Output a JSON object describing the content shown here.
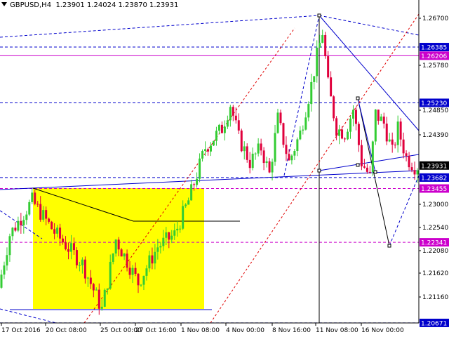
{
  "header": {
    "symbol_timeframe": "GBPUSD,H4",
    "ohlc": "1.23901 1.24024 1.23870 1.23931"
  },
  "colors": {
    "background": "#ffffff",
    "up_candle": "#33cc33",
    "down_candle": "#e0003c",
    "rectangle": "#ffff00",
    "trend_blue": "#0000cc",
    "level_magenta": "#cc00cc",
    "channel_red": "#e00000",
    "tag_blue": "#0000cc",
    "tag_magenta": "#cc00cc"
  },
  "chart_data": {
    "type": "candlestick",
    "title": "GBPUSD,H4",
    "ylim": [
      1.2067,
      1.2736
    ],
    "y_ticks": [
      "1.26700",
      "1.25780",
      "1.24850",
      "1.24390",
      "1.23000",
      "1.22540",
      "1.22080",
      "1.21620",
      "1.21160"
    ],
    "x_ticks": [
      "17 Oct 2016",
      "20 Oct 08:00",
      "25 Oct 00:00",
      "27 Oct 16:00",
      "1 Nov 08:00",
      "4 Nov 00:00",
      "8 Nov 16:00",
      "11 Nov 08:00",
      "16 Nov 00:00"
    ],
    "price_tags": [
      {
        "label": "1.26385",
        "value": 1.26385,
        "color": "blue"
      },
      {
        "label": "1.26206",
        "value": 1.26206,
        "color": "magenta"
      },
      {
        "label": "1.25230",
        "value": 1.2523,
        "color": "blue"
      },
      {
        "label": "1.23931",
        "value": 1.23931,
        "color": "black"
      },
      {
        "label": "1.23682",
        "value": 1.23682,
        "color": "blue"
      },
      {
        "label": "1.23455",
        "value": 1.23455,
        "color": "magenta"
      },
      {
        "label": "1.22341",
        "value": 1.22341,
        "color": "magenta"
      },
      {
        "label": "1.20671",
        "value": 1.20671,
        "color": "blue"
      }
    ],
    "waypoints": [
      [
        0,
        1.214
      ],
      [
        4,
        1.225
      ],
      [
        12,
        1.232
      ],
      [
        20,
        1.2255
      ],
      [
        30,
        1.219
      ],
      [
        37,
        1.2095
      ],
      [
        42,
        1.224
      ],
      [
        50,
        1.215
      ],
      [
        57,
        1.2225
      ],
      [
        63,
        1.225
      ],
      [
        68,
        1.232
      ],
      [
        74,
        1.243
      ],
      [
        80,
        1.247
      ],
      [
        83,
        1.252
      ],
      [
        86,
        1.245
      ],
      [
        90,
        1.24
      ],
      [
        94,
        1.243
      ],
      [
        97,
        1.2375
      ],
      [
        100,
        1.249
      ],
      [
        104,
        1.24
      ],
      [
        108,
        1.246
      ],
      [
        112,
        1.256
      ],
      [
        114,
        1.262
      ],
      [
        116,
        1.267
      ],
      [
        118,
        1.256
      ],
      [
        121,
        1.247
      ],
      [
        124,
        1.246
      ],
      [
        127,
        1.251
      ],
      [
        130,
        1.24
      ],
      [
        133,
        1.237
      ],
      [
        135,
        1.25
      ],
      [
        138,
        1.248
      ],
      [
        141,
        1.242
      ],
      [
        143,
        1.247
      ],
      [
        146,
        1.241
      ],
      [
        149,
        1.2392
      ]
    ]
  }
}
